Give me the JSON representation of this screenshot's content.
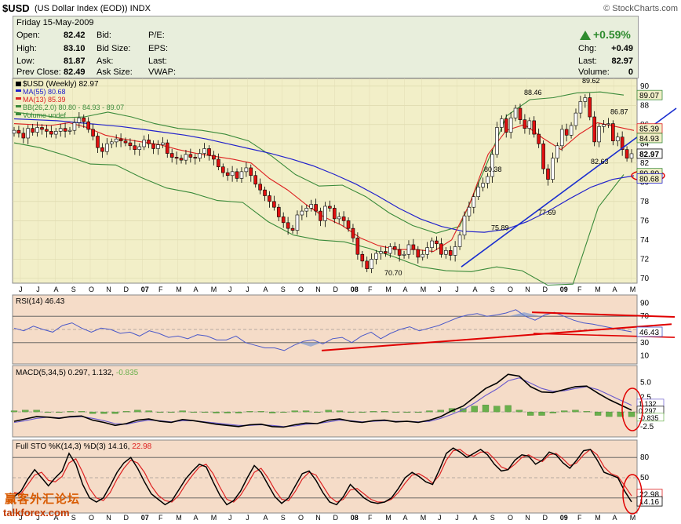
{
  "header": {
    "symbol": "$USD",
    "description": "(US Dollar Index (EOD))",
    "exchange": "INDX",
    "brand": "© StockCharts.com"
  },
  "quote": {
    "date_line": "Friday   15-May-2009",
    "open_label": "Open:",
    "open": "82.42",
    "high_label": "High:",
    "high": "83.10",
    "low_label": "Low:",
    "low": "81.87",
    "prev_label": "Prev Close:",
    "prev": "82.49",
    "bid_label": "Bid:",
    "bidsize_label": "Bid Size:",
    "ask_label": "Ask:",
    "asksize_label": "Ask Size:",
    "pe_label": "P/E:",
    "eps_label": "EPS:",
    "last_label": "Last:",
    "vwap_label": "VWAP:",
    "change_pct": "+0.59%",
    "chg_label": "Chg:",
    "chg": "+0.49",
    "last2_label": "Last:",
    "last": "82.97",
    "volume_label": "Volume:",
    "volume": "0",
    "up_color": "#2e8b2e"
  },
  "legend": {
    "main": "$USD (Weekly) 82.97",
    "ma55": "MA(55) 80.68",
    "ma13": "MA(13) 85.39",
    "bb": "BB(26,2.0) 80.80 - 84.93 - 89.07",
    "volume": "Volume undef"
  },
  "colors": {
    "price_bg": "#f2efc8",
    "ind_bg": "#f5dcc8",
    "quote_bg": "#e8eedc",
    "up_candle": "#ffffff",
    "down_candle": "#e01010",
    "ma55": "#2222cc",
    "ma13": "#dd2222",
    "bb": "#3a8a3a",
    "rsi": "#4a58c8",
    "macd": "#000000",
    "signal": "#6a5acd",
    "hist": "#6ab04c",
    "sto_k": "#000000",
    "sto_d": "#dd2222",
    "annot_red": "#e00000",
    "annot_blue": "#1a2ecf"
  },
  "chart_data": [
    {
      "type": "candlestick",
      "title": "$USD (Weekly) 82.97",
      "ylim": [
        69.5,
        90.8
      ],
      "yticks": [
        "70",
        "72",
        "74",
        "76",
        "78",
        "80",
        "82",
        "84",
        "86",
        "88",
        "90"
      ],
      "x_labels": [
        "J",
        "J",
        "A",
        "S",
        "O",
        "N",
        "D",
        "07",
        "F",
        "M",
        "A",
        "M",
        "J",
        "J",
        "A",
        "S",
        "O",
        "N",
        "D",
        "08",
        "F",
        "M",
        "A",
        "M",
        "J",
        "J",
        "A",
        "S",
        "O",
        "N",
        "D",
        "09",
        "F",
        "M",
        "A",
        "M"
      ],
      "annotations": [
        "70.70",
        "75.89",
        "77.69",
        "80.38",
        "82.63",
        "86.87",
        "88.46",
        "89.62"
      ],
      "price_tags": [
        "89.07",
        "85.39",
        "84.93",
        "82.97",
        "80.80",
        "80.68"
      ],
      "close_series": [
        85.4,
        85.1,
        84.6,
        85.6,
        85.2,
        85.7,
        85.5,
        85.3,
        85.0,
        85.3,
        85.6,
        85.3,
        85.4,
        86.2,
        86.7,
        86.3,
        85.5,
        84.8,
        83.6,
        83.2,
        84.0,
        84.2,
        84.5,
        84.3,
        84.1,
        83.8,
        83.4,
        83.7,
        84.4,
        84.0,
        83.5,
        83.9,
        84.1,
        83.0,
        82.6,
        82.5,
        82.3,
        82.9,
        82.6,
        82.5,
        83.0,
        83.5,
        82.8,
        82.4,
        81.6,
        81.0,
        80.7,
        81.1,
        80.4,
        81.1,
        81.5,
        80.7,
        79.8,
        79.2,
        78.6,
        78.0,
        77.4,
        76.4,
        75.8,
        75.2,
        75.0,
        76.6,
        77.0,
        77.3,
        77.7,
        77.0,
        76.0,
        77.5,
        77.3,
        76.2,
        76.4,
        76.0,
        75.2,
        74.2,
        72.5,
        71.8,
        71.0,
        72.0,
        72.6,
        72.8,
        72.6,
        73.3,
        73.0,
        72.4,
        72.5,
        73.5,
        73.0,
        72.2,
        72.5,
        73.2,
        73.9,
        73.6,
        72.5,
        72.9,
        72.4,
        73.3,
        74.5,
        76.5,
        77.4,
        78.5,
        79.5,
        79.9,
        80.6,
        82.9,
        85.7,
        86.6,
        85.2,
        86.7,
        87.7,
        86.5,
        85.6,
        86.4,
        85.0,
        84.0,
        81.4,
        80.3,
        82.5,
        83.8,
        85.5,
        84.9,
        85.9,
        87.2,
        88.4,
        88.8,
        86.8,
        84.2,
        85.8,
        86.0,
        86.1,
        84.3,
        84.7,
        83.4,
        82.5,
        82.97
      ],
      "ma55_series": [
        86.6,
        86.5,
        86.4,
        86.2,
        86.0,
        85.8,
        85.5,
        85.2,
        84.9,
        84.5,
        84.0,
        83.5,
        83.0,
        82.4,
        81.7,
        80.8,
        79.8,
        78.6,
        77.3,
        76.2,
        75.4,
        74.9,
        74.8,
        75.1,
        75.9,
        77.0,
        78.3,
        79.5,
        80.3,
        80.68
      ],
      "ma13_series": [
        86.1,
        86.0,
        85.9,
        86.2,
        85.7,
        84.9,
        84.5,
        84.2,
        83.9,
        83.4,
        83.0,
        82.7,
        82.4,
        82.0,
        80.4,
        79.2,
        77.7,
        76.4,
        75.5,
        74.2,
        73.4,
        73.0,
        73.0,
        72.8,
        74.0,
        77.8,
        82.9,
        85.4,
        86.0,
        84.6,
        83.4,
        85.0,
        86.2,
        85.8,
        85.39
      ],
      "bb_upper_series": [
        87.3,
        87.0,
        86.7,
        86.8,
        87.3,
        86.8,
        86.1,
        85.6,
        85.4,
        85.0,
        84.3,
        82.7,
        80.8,
        79.6,
        79.7,
        78.5,
        76.8,
        75.5,
        74.7,
        75.4,
        81.0,
        86.9,
        88.6,
        88.8,
        89.3,
        89.4,
        89.07
      ],
      "bb_lower_series": [
        84.1,
        83.6,
        82.8,
        81.9,
        81.8,
        80.5,
        79.4,
        78.9,
        78.1,
        77.9,
        75.9,
        74.5,
        74.0,
        73.8,
        73.1,
        72.2,
        71.2,
        70.8,
        70.7,
        71.2,
        70.8,
        69.3,
        69.4,
        77.4,
        80.8
      ],
      "trendline": {
        "from": "75.89",
        "to": "82.63"
      }
    },
    {
      "type": "line",
      "title": "RSI(14) 46.43",
      "ylim": [
        0,
        100
      ],
      "yticks": [
        "90",
        "70",
        "50",
        "30",
        "10"
      ],
      "value_label": "46.43",
      "series": [
        {
          "name": "RSI(14)",
          "values": [
            52,
            48,
            55,
            50,
            46,
            56,
            60,
            52,
            46,
            52,
            50,
            44,
            46,
            40,
            48,
            44,
            38,
            40,
            36,
            42,
            40,
            34,
            34,
            40,
            30,
            26,
            22,
            22,
            18,
            26,
            32,
            34,
            28,
            36,
            38,
            30,
            40,
            46,
            36,
            44,
            50,
            54,
            48,
            52,
            56,
            62,
            68,
            72,
            74,
            70,
            72,
            75,
            80,
            70,
            64,
            72,
            76,
            70,
            64,
            60,
            58,
            55,
            52,
            49,
            46.43
          ]
        }
      ]
    },
    {
      "type": "line",
      "title": "MACD(5,34,5) 0.297, 1.132, -0.835",
      "ylim": [
        -4.0,
        7.5
      ],
      "yticks": [
        "5.0",
        "2.5",
        "0.0",
        "-2.5"
      ],
      "value_labels": [
        "1.132",
        "0.297",
        "-0.835"
      ],
      "series": [
        {
          "name": "MACD(5,34,5)",
          "values": [
            -1.6,
            -1.2,
            -0.8,
            -0.9,
            -1.1,
            -0.8,
            -0.7,
            -1.4,
            -1.8,
            -2.3,
            -2.0,
            -1.4,
            -1.2,
            -1.6,
            -1.8,
            -1.3,
            -1.5,
            -1.8,
            -2.1,
            -2.3,
            -2.5,
            -2.2,
            -2.1,
            -2.5,
            -2.6,
            -2.2,
            -1.9,
            -2.0,
            -1.4,
            -1.2,
            -1.6,
            -1.8,
            -1.5,
            -1.4,
            -1.7,
            -1.6,
            -1.8,
            -1.4,
            -0.8,
            0.2,
            1.0,
            2.5,
            4.0,
            4.9,
            6.4,
            6.1,
            4.3,
            3.4,
            3.3,
            3.8,
            4.3,
            4.4,
            3.2,
            2.1,
            1.2,
            0.297
          ]
        },
        {
          "name": "signal",
          "values": [
            -1.8,
            -1.5,
            -1.1,
            -0.9,
            -1.0,
            -0.9,
            -0.8,
            -1.1,
            -1.5,
            -2.0,
            -2.1,
            -1.7,
            -1.4,
            -1.5,
            -1.7,
            -1.5,
            -1.5,
            -1.7,
            -1.9,
            -2.1,
            -2.3,
            -2.3,
            -2.2,
            -2.3,
            -2.5,
            -2.4,
            -2.1,
            -2.0,
            -1.7,
            -1.4,
            -1.5,
            -1.7,
            -1.6,
            -1.5,
            -1.6,
            -1.6,
            -1.7,
            -1.6,
            -1.1,
            -0.4,
            0.4,
            1.5,
            2.8,
            3.9,
            5.3,
            5.8,
            4.9,
            4.0,
            3.5,
            3.6,
            4.0,
            4.3,
            3.8,
            2.9,
            2.0,
            1.132
          ]
        },
        {
          "name": "histogram",
          "values": [
            0.2,
            0.3,
            0.3,
            0.0,
            -0.1,
            0.1,
            0.1,
            -0.3,
            -0.3,
            -0.3,
            0.1,
            0.3,
            0.2,
            -0.1,
            -0.1,
            0.2,
            0.0,
            -0.1,
            -0.2,
            -0.2,
            -0.2,
            0.1,
            0.1,
            -0.2,
            -0.1,
            0.2,
            0.2,
            0.0,
            0.3,
            0.2,
            -0.1,
            -0.1,
            0.1,
            0.1,
            -0.1,
            0.0,
            -0.1,
            0.2,
            0.3,
            0.6,
            0.6,
            1.0,
            1.2,
            1.0,
            1.1,
            0.3,
            -0.6,
            -0.6,
            -0.2,
            0.2,
            0.3,
            0.1,
            -0.6,
            -0.8,
            -0.8,
            -0.835
          ]
        }
      ]
    },
    {
      "type": "line",
      "title": "Full STO %K(14,3) %D(3) 14.16, 22.98",
      "ylim": [
        0,
        100
      ],
      "yticks": [
        "80",
        "50",
        "20"
      ],
      "value_labels": [
        "22.98",
        "14.16"
      ],
      "series": [
        {
          "name": "%K(14,3)",
          "values": [
            22,
            30,
            48,
            62,
            50,
            38,
            50,
            60,
            86,
            70,
            40,
            20,
            14,
            20,
            38,
            58,
            72,
            80,
            64,
            44,
            26,
            18,
            10,
            16,
            32,
            48,
            60,
            70,
            66,
            44,
            24,
            10,
            16,
            30,
            50,
            68,
            58,
            40,
            22,
            12,
            20,
            38,
            56,
            60,
            46,
            28,
            14,
            10,
            22,
            40,
            30,
            20,
            14,
            12,
            14,
            20,
            34,
            50,
            58,
            52,
            44,
            40,
            62,
            86,
            94,
            88,
            80,
            86,
            92,
            84,
            70,
            60,
            62,
            76,
            84,
            82,
            70,
            76,
            88,
            84,
            72,
            64,
            76,
            90,
            92,
            76,
            58,
            54,
            50,
            30,
            14.16
          ]
        },
        {
          "name": "%D(3)",
          "values": [
            28,
            26,
            40,
            54,
            58,
            46,
            44,
            52,
            72,
            78,
            58,
            34,
            20,
            16,
            28,
            48,
            64,
            76,
            72,
            58,
            38,
            24,
            16,
            14,
            24,
            40,
            54,
            66,
            70,
            56,
            36,
            18,
            14,
            24,
            40,
            58,
            64,
            50,
            32,
            18,
            16,
            30,
            48,
            58,
            54,
            38,
            22,
            14,
            18,
            32,
            34,
            26,
            18,
            14,
            14,
            18,
            28,
            42,
            54,
            56,
            50,
            42,
            54,
            76,
            90,
            92,
            84,
            82,
            88,
            88,
            78,
            66,
            62,
            70,
            80,
            84,
            78,
            74,
            84,
            86,
            78,
            68,
            72,
            84,
            92,
            84,
            66,
            56,
            52,
            38,
            22.98
          ]
        }
      ]
    }
  ],
  "watermark": {
    "chinese": "赢客外汇论坛",
    "site": "talkforex.com"
  }
}
